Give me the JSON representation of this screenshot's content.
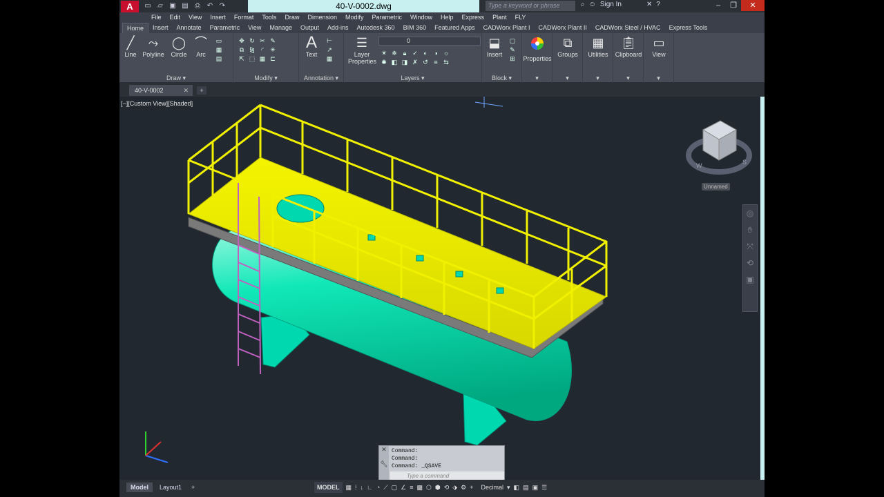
{
  "app": {
    "logo": "A",
    "document_title": "40-V-0002.dwg",
    "search_placeholder": "Type a keyword or phrase",
    "sign_in": "Sign In"
  },
  "menu": [
    "File",
    "Edit",
    "View",
    "Insert",
    "Format",
    "Tools",
    "Draw",
    "Dimension",
    "Modify",
    "Parametric",
    "Window",
    "Help",
    "Express",
    "Plant",
    "FLY"
  ],
  "ribbon_tabs": [
    "Home",
    "Insert",
    "Annotate",
    "Parametric",
    "View",
    "Manage",
    "Output",
    "Add-ins",
    "Autodesk 360",
    "BIM 360",
    "Featured Apps",
    "CADWorx Plant I",
    "CADWorx Plant II",
    "CADWorx Steel / HVAC",
    "Express Tools"
  ],
  "active_tab": "Home",
  "ribbon": {
    "draw_tools": [
      "Line",
      "Polyline",
      "Circle",
      "Arc"
    ],
    "draw_title": "Draw",
    "modify_title": "Modify",
    "text_label": "Text",
    "annotation_title": "Annotation",
    "layer_properties": "Layer Properties",
    "layer_current": "0",
    "layers_title": "Layers",
    "insert_label": "Insert",
    "block_title": "Block",
    "properties_label": "Properties",
    "groups_label": "Groups",
    "utilities_label": "Utilities",
    "clipboard_label": "Clipboard",
    "view_label": "View"
  },
  "file_tab": "40-V-0002",
  "viewport": {
    "label": "[−][Custom View][Shaded]",
    "viewcube_label": "Unnamed",
    "compass": [
      "W",
      "S"
    ]
  },
  "command": {
    "lines": [
      "Command:",
      "Command:",
      "Command: _QSAVE"
    ],
    "placeholder": "Type a command"
  },
  "status": {
    "layout_tabs": [
      "Model",
      "Layout1"
    ],
    "model": "MODEL",
    "units": "Decimal"
  },
  "colors": {
    "accent": "#c8f0f0",
    "viewport_bg": "#212830",
    "platform": "#ecec00",
    "vessel": "#00e6b4"
  }
}
